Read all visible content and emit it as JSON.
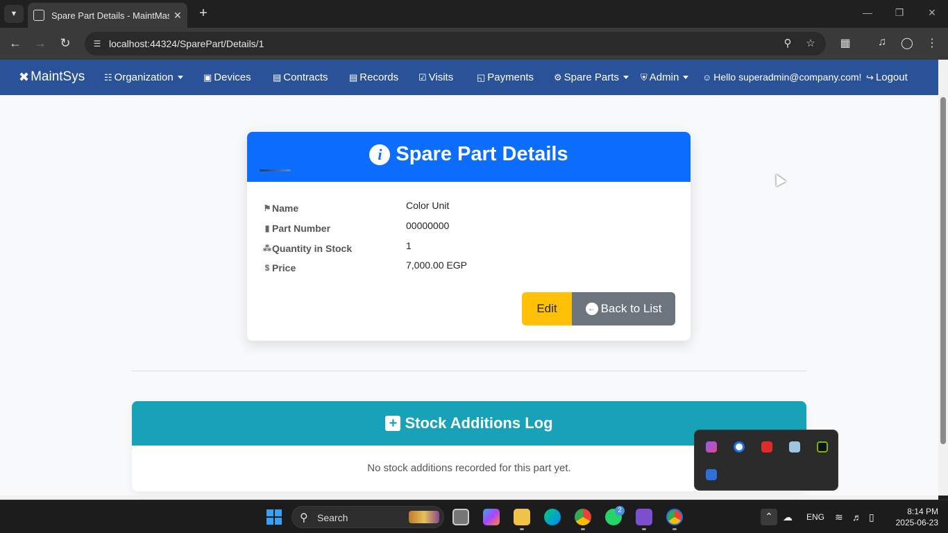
{
  "browser": {
    "tab_title": "Spare Part Details - MaintMaster",
    "url": "localhost:44324/SparePart/Details/1"
  },
  "navbar": {
    "brand": "MaintSys",
    "items": [
      {
        "label": "Organization",
        "icon": "sitemap-icon"
      },
      {
        "label": "Devices",
        "icon": "chip-icon"
      },
      {
        "label": "Contracts",
        "icon": "document-icon"
      },
      {
        "label": "Records",
        "icon": "list-icon"
      },
      {
        "label": "Visits",
        "icon": "calendar-check-icon"
      },
      {
        "label": "Payments",
        "icon": "cash-icon"
      },
      {
        "label": "Spare Parts",
        "icon": "gear-icon"
      },
      {
        "label": "Admin",
        "icon": "shield-icon"
      }
    ],
    "greeting": "Hello superadmin@company.com!",
    "logout": "Logout"
  },
  "details": {
    "title": "Spare Part Details",
    "fields": [
      {
        "label": "Name",
        "value": "Color Unit",
        "icon": "tag-icon"
      },
      {
        "label": "Part Number",
        "value": "00000000",
        "icon": "barcode-icon"
      },
      {
        "label": "Quantity in Stock",
        "value": "1",
        "icon": "boxes-icon"
      },
      {
        "label": "Price",
        "value": "7,000.00 EGP",
        "icon": "dollar-icon"
      }
    ],
    "edit_label": "Edit",
    "back_label": "Back to List"
  },
  "stock_log": {
    "title": "Stock Additions Log",
    "empty_message": "No stock additions recorded for this part yet."
  },
  "taskbar": {
    "search_label": "Search",
    "whatsapp_badge": "2",
    "language": "ENG",
    "time": "8:14 PM",
    "date": "2025-06-23"
  },
  "colors": {
    "navbar": "#2a5298",
    "details_header": "#0d6efd",
    "log_header": "#17a2b8",
    "edit_button": "#ffc107",
    "back_button": "#6c757d"
  }
}
